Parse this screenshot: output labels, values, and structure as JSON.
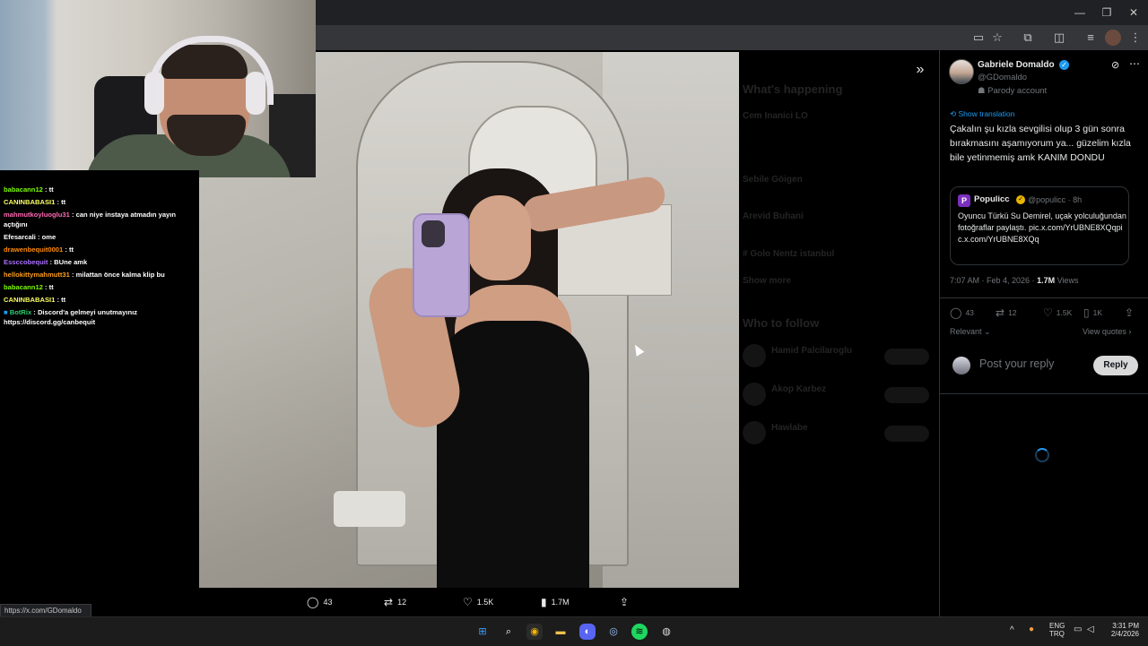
{
  "browser": {
    "window_controls": [
      "—",
      "❐",
      "✕"
    ],
    "toolbar_icons": [
      "cast-icon",
      "star-icon",
      "extensions-icon",
      "sidepanel-icon",
      "media-icon",
      "profile-avatar",
      "menu-icon"
    ],
    "status_link": "https://x.com/GDomaldo"
  },
  "chat": {
    "messages": [
      {
        "user": "babacann12",
        "color": "#7cfc00",
        "text": "tt"
      },
      {
        "user": "CANINBABASI1",
        "color": "#ffff66",
        "text": "tt"
      },
      {
        "user": "mahmutkoyluoglu31",
        "color": "#ff69b4",
        "text": "can niye instaya atmadın yayın açtığını"
      },
      {
        "user": "Efesarcali",
        "color": "#ffffff",
        "text": "ome"
      },
      {
        "user": "drawenbequit0001",
        "color": "#ff8c00",
        "text": "tt"
      },
      {
        "user": "Essccobequit",
        "color": "#a970ff",
        "text": "BUne amk"
      },
      {
        "user": "hellokittymahmutt31",
        "color": "#ff9f1a",
        "text": "milattan önce kalma klip bu"
      },
      {
        "user": "babacann12",
        "color": "#7cfc00",
        "text": "tt"
      },
      {
        "user": "CANINBABASI1",
        "color": "#ffff66",
        "text": "tt"
      },
      {
        "user": "BotRix",
        "color": "#2ecc71",
        "text": "Discord'a gelmeyi unutmayınız https://discord.gg/canbequit"
      }
    ]
  },
  "media_bar": {
    "replies": "43",
    "retweets": "12",
    "likes": "1.5K",
    "views": "1.7M"
  },
  "tweet": {
    "author_name": "Gabriele Domaldo",
    "handle": "@GDomaldo",
    "parody_label": "Parody account",
    "show_translation": "Show translation",
    "text": "Çakalın şu kızla sevgilisi olup 3 gün sonra bırakmasını aşamıyorum ya... güzelim kızla bile yetinmemiş amk KANIM DONDU",
    "quote": {
      "logo": "P",
      "name": "Populicc",
      "handle_time": "@populicc · 8h",
      "text": "Oyuncu Türkü Su Demirel, uçak yolculuğundan fotoğraflar paylaştı. pic.x.com/YrUBNE8XQqpic.x.com/YrUBNE8XQq"
    },
    "timestamp": "7:07 AM · Feb 4, 2026 · ",
    "views_count": "1.7M",
    "views_label": "Views",
    "actions": {
      "replies": "43",
      "retweets": "12",
      "likes": "1.5K",
      "bookmarks": "1K"
    },
    "relevant": "Relevant",
    "view_quotes": "View quotes",
    "reply_placeholder": "Post your reply",
    "reply_button": "Reply"
  },
  "background_sidebar": {
    "section1": "What's happening",
    "section2": "Who to follow",
    "items": [
      "Cem Inanici LO",
      "Sebile Göigen",
      "Arevid Buhani",
      "# Golo Nentz istanbul",
      "Show more"
    ],
    "follow_names": [
      "Hamid Palcilaroglu",
      "Akop Karbez",
      "Hawlabe"
    ],
    "follow_button": "Follow"
  },
  "taskbar": {
    "apps": [
      "windows-start-icon",
      "search-icon",
      "chrome-icon",
      "file-explorer-icon",
      "discord-icon",
      "steam-icon",
      "spotify-icon",
      "obs-icon"
    ],
    "language": "ENG",
    "region": "TRQ",
    "time": "3:31 PM",
    "date": "2/4/2026"
  }
}
